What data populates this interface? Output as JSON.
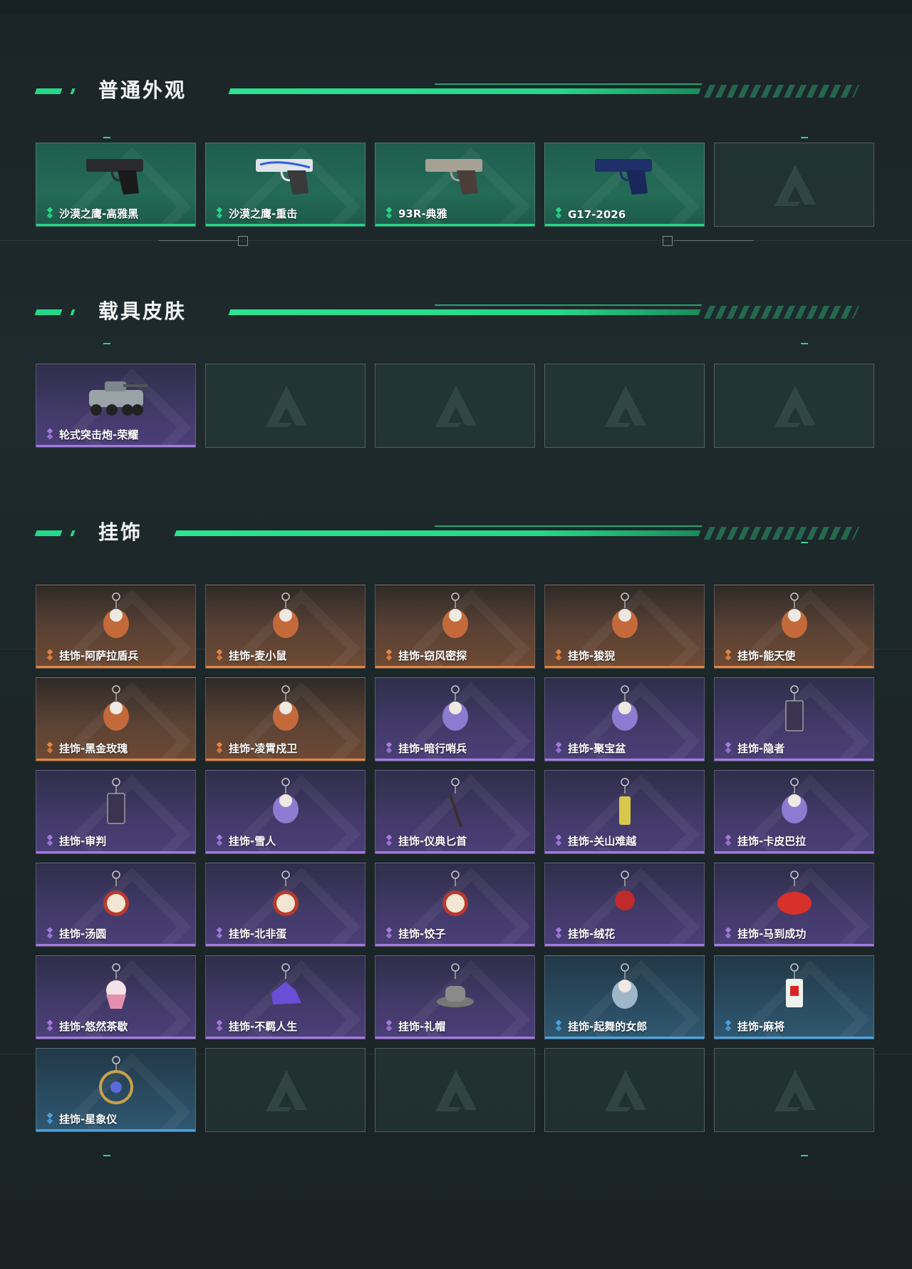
{
  "sections": [
    {
      "title": "普通外观",
      "items": [
        {
          "label": "沙漠之鹰-高雅黑",
          "rarity": "green",
          "icon": "pistol-deagle-black-icon"
        },
        {
          "label": "沙漠之鹰-重击",
          "rarity": "green",
          "icon": "pistol-deagle-white-blue-icon"
        },
        {
          "label": "93R-典雅",
          "rarity": "green",
          "icon": "pistol-93r-icon"
        },
        {
          "label": "G17-2026",
          "rarity": "green",
          "icon": "pistol-g17-blue-icon"
        },
        {
          "label": "",
          "rarity": "empty",
          "icon": "empty-slot-logo-icon"
        }
      ]
    },
    {
      "title": "载具皮肤",
      "items": [
        {
          "label": "轮式突击炮-荣耀",
          "rarity": "purple",
          "icon": "armored-vehicle-icon"
        },
        {
          "label": "",
          "rarity": "empty",
          "icon": "empty-slot-logo-icon"
        },
        {
          "label": "",
          "rarity": "empty",
          "icon": "empty-slot-logo-icon"
        },
        {
          "label": "",
          "rarity": "empty",
          "icon": "empty-slot-logo-icon"
        },
        {
          "label": "",
          "rarity": "empty",
          "icon": "empty-slot-logo-icon"
        }
      ]
    },
    {
      "title": "挂饰",
      "items": [
        {
          "label": "挂饰-阿萨拉盾兵",
          "rarity": "orange",
          "icon": "charm-shield-soldier-icon"
        },
        {
          "label": "挂饰-麦小鼠",
          "rarity": "orange",
          "icon": "charm-mouse-icon"
        },
        {
          "label": "挂饰-窃风密探",
          "rarity": "orange",
          "icon": "charm-rabbit-spy-icon"
        },
        {
          "label": "挂饰-狻猊",
          "rarity": "orange",
          "icon": "charm-suanni-icon"
        },
        {
          "label": "挂饰-能天使",
          "rarity": "orange",
          "icon": "charm-angel-icon"
        },
        {
          "label": "挂饰-黑金玫瑰",
          "rarity": "orange",
          "icon": "charm-black-rose-icon"
        },
        {
          "label": "挂饰-凌霄戍卫",
          "rarity": "orange",
          "icon": "charm-guard-icon"
        },
        {
          "label": "挂饰-暗行哨兵",
          "rarity": "purple",
          "icon": "charm-sentinel-icon"
        },
        {
          "label": "挂饰-聚宝盆",
          "rarity": "purple",
          "icon": "charm-treasure-bowl-icon"
        },
        {
          "label": "挂饰-隐者",
          "rarity": "purple",
          "icon": "charm-hermit-card-icon"
        },
        {
          "label": "挂饰-审判",
          "rarity": "purple",
          "icon": "charm-judgement-card-icon"
        },
        {
          "label": "挂饰-雪人",
          "rarity": "purple",
          "icon": "charm-snowman-icon"
        },
        {
          "label": "挂饰-仪典匕首",
          "rarity": "purple",
          "icon": "charm-dagger-icon"
        },
        {
          "label": "挂饰-关山难越",
          "rarity": "purple",
          "icon": "charm-yellow-tube-icon"
        },
        {
          "label": "挂饰-卡皮巴拉",
          "rarity": "purple",
          "icon": "charm-capybara-icon"
        },
        {
          "label": "挂饰-汤圆",
          "rarity": "purple",
          "icon": "charm-tangyuan-icon"
        },
        {
          "label": "挂饰-北非蛋",
          "rarity": "purple",
          "icon": "charm-shakshuka-icon"
        },
        {
          "label": "挂饰-饺子",
          "rarity": "purple",
          "icon": "charm-dumplings-icon"
        },
        {
          "label": "挂饰-绒花",
          "rarity": "purple",
          "icon": "charm-velvet-flower-icon"
        },
        {
          "label": "挂饰-马到成功",
          "rarity": "purple",
          "icon": "charm-red-horse-icon"
        },
        {
          "label": "挂饰-悠然茶歇",
          "rarity": "purple",
          "icon": "charm-cupcake-icon"
        },
        {
          "label": "挂饰-不羁人生",
          "rarity": "purple",
          "icon": "charm-sneaker-icon"
        },
        {
          "label": "挂饰-礼帽",
          "rarity": "purple",
          "icon": "charm-hat-icon"
        },
        {
          "label": "挂饰-起舞的女郎",
          "rarity": "blue",
          "icon": "charm-dancer-icon"
        },
        {
          "label": "挂饰-麻将",
          "rarity": "blue",
          "icon": "charm-mahjong-icon"
        },
        {
          "label": "挂饰-星象仪",
          "rarity": "blue",
          "icon": "charm-astrolabe-icon"
        },
        {
          "label": "",
          "rarity": "empty",
          "icon": "empty-slot-logo-icon"
        },
        {
          "label": "",
          "rarity": "empty",
          "icon": "empty-slot-logo-icon"
        },
        {
          "label": "",
          "rarity": "empty",
          "icon": "empty-slot-logo-icon"
        },
        {
          "label": "",
          "rarity": "empty",
          "icon": "empty-slot-logo-icon"
        }
      ]
    }
  ],
  "colors": {
    "accent": "#25d889",
    "rarity_green": "#25d889",
    "rarity_purple": "#a47ae0",
    "rarity_orange": "#e8833e",
    "rarity_blue": "#4ba3e0"
  }
}
